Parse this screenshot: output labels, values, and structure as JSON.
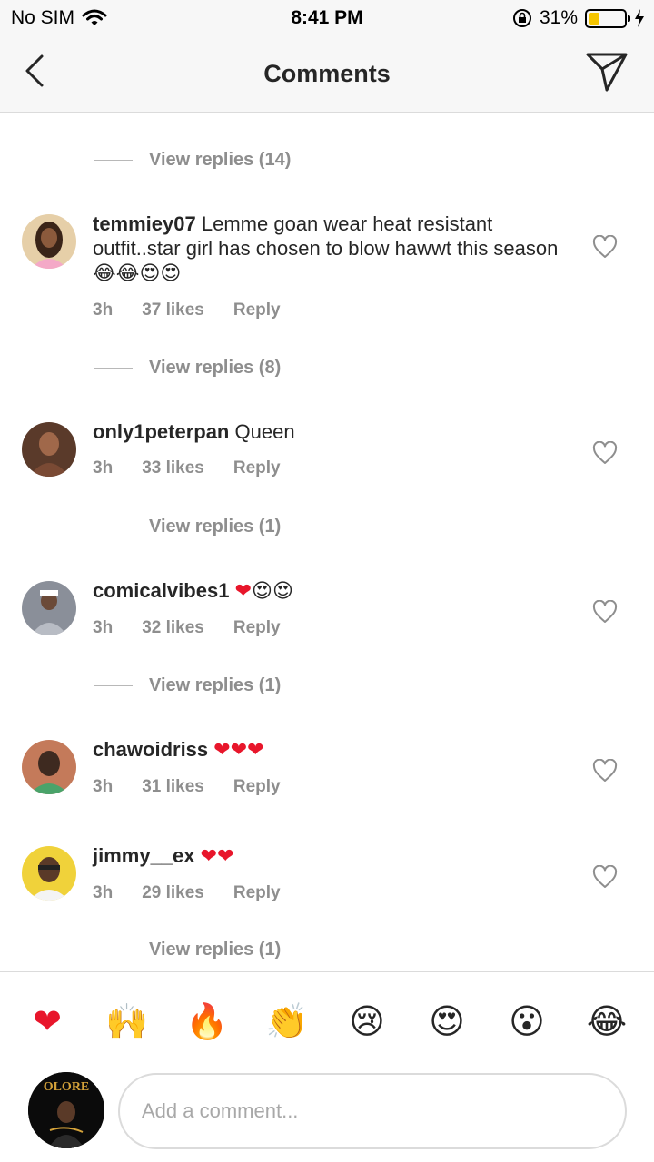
{
  "status": {
    "carrier": "No SIM",
    "time": "8:41 PM",
    "battery": "31%",
    "battery_level": 0.31,
    "battery_color": "#f5c500"
  },
  "header": {
    "title": "Comments"
  },
  "replies_labels": [
    "View replies (14)",
    "View replies (8)",
    "View replies (1)",
    "View replies (1)",
    "View replies (1)"
  ],
  "comments": [
    {
      "user": "temmiey07",
      "text": "Lemme goan wear heat resistant outfit..star girl has chosen to blow hawwt this season",
      "emojis": "😂😂😍😍",
      "time": "3h",
      "likes": "37 likes",
      "reply": "Reply"
    },
    {
      "user": "only1peterpan",
      "text": "Queen",
      "emojis": "",
      "time": "3h",
      "likes": "33 likes",
      "reply": "Reply"
    },
    {
      "user": "comicalvibes1",
      "text": "",
      "emojis": "❤😍😍",
      "time": "3h",
      "likes": "32 likes",
      "reply": "Reply"
    },
    {
      "user": "chawoidriss",
      "text": "",
      "emojis": "❤❤❤",
      "time": "3h",
      "likes": "31 likes",
      "reply": "Reply"
    },
    {
      "user": "jimmy__ex",
      "text": "",
      "emojis": "❤❤",
      "time": "3h",
      "likes": "29 likes",
      "reply": "Reply"
    }
  ],
  "quick_emojis": [
    "❤",
    "🙌",
    "🔥",
    "👏",
    "😢",
    "😍",
    "😮",
    "😂"
  ],
  "composer": {
    "placeholder": "Add a comment...",
    "avatar_text": "OLORE"
  },
  "colors": {
    "meta_gray": "#8e8e8e",
    "heart_red": "#e8162b",
    "divider": "#dbdbdb"
  }
}
